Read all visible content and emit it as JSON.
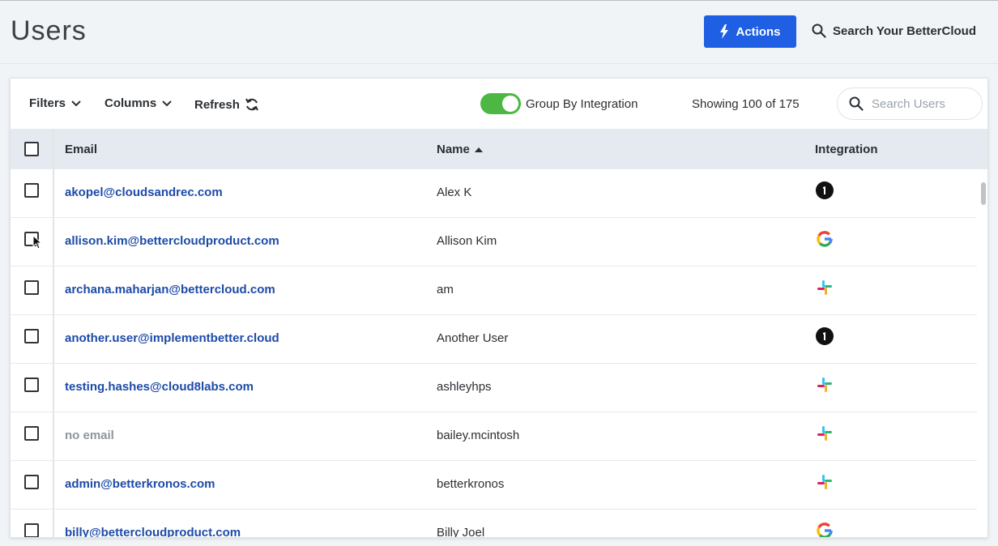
{
  "header": {
    "title": "Users",
    "actions_label": "Actions",
    "global_search_label": "Search Your BetterCloud"
  },
  "toolbar": {
    "filters_label": "Filters",
    "columns_label": "Columns",
    "refresh_label": "Refresh",
    "group_by_label": "Group By Integration",
    "group_by_enabled": true,
    "showing_text": "Showing 100 of 175",
    "search_placeholder": "Search Users"
  },
  "table": {
    "columns": {
      "email": "Email",
      "name": "Name",
      "integration": "Integration"
    },
    "sort": {
      "column": "name",
      "direction": "asc"
    },
    "rows": [
      {
        "email": "akopel@cloudsandrec.com",
        "name": "Alex K",
        "integration": "1password-icon"
      },
      {
        "email": "allison.kim@bettercloudproduct.com",
        "name": "Allison Kim",
        "integration": "google-icon"
      },
      {
        "email": "archana.maharjan@bettercloud.com",
        "name": "am",
        "integration": "slack-icon"
      },
      {
        "email": "another.user@implementbetter.cloud",
        "name": "Another User",
        "integration": "1password-icon"
      },
      {
        "email": "testing.hashes@cloud8labs.com",
        "name": "ashleyhps",
        "integration": "slack-icon"
      },
      {
        "email": "no email",
        "name": "bailey.mcintosh",
        "integration": "slack-icon"
      },
      {
        "email": "admin@betterkronos.com",
        "name": "betterkronos",
        "integration": "slack-icon"
      },
      {
        "email": "billy@bettercloudproduct.com",
        "name": "Billy Joel",
        "integration": "google-icon"
      }
    ]
  },
  "colors": {
    "primary": "#1f5fe3",
    "link": "#1d4ba8",
    "toggle_on": "#4cb843",
    "header_bg": "#e4eaef"
  }
}
